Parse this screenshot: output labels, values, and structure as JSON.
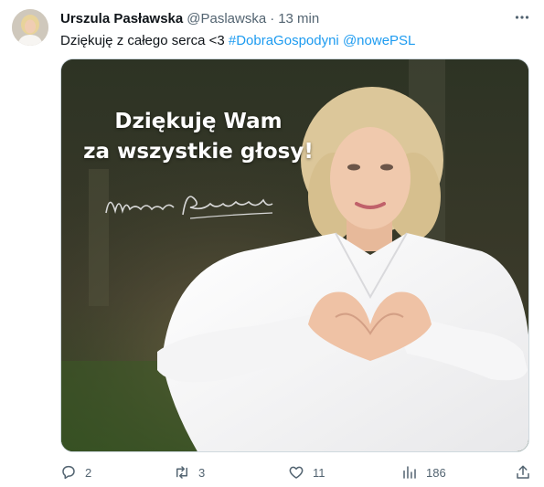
{
  "author": {
    "display_name": "Urszula Pasławska",
    "handle": "@Paslawska",
    "separator": "·",
    "time": "13 min"
  },
  "tweet": {
    "text": "Dziękuję z całego serca <3 ",
    "hashtag": "#DobraGospodyni",
    "mention": "@nowePSL"
  },
  "media": {
    "headline_line1": "Dziękuję Wam",
    "headline_line2": "za wszystkie głosy!",
    "signature": "Urszula Pasławska"
  },
  "actions": {
    "replies": "2",
    "retweets": "3",
    "likes": "11",
    "views": "186"
  },
  "icons": [
    "more-icon",
    "reply-icon",
    "retweet-icon",
    "like-icon",
    "views-icon",
    "share-icon"
  ],
  "colors": {
    "link": "#1d9bf0",
    "secondary_text": "#536471",
    "primary_text": "#0f1419"
  }
}
